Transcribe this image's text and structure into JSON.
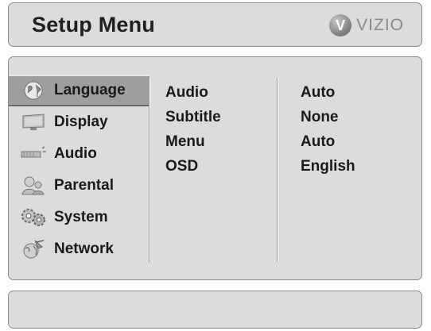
{
  "header": {
    "title": "Setup Menu",
    "logo_text": "VIZIO",
    "logo_letter": "V"
  },
  "sidebar": {
    "items": [
      {
        "label": "Language",
        "icon": "globe-icon",
        "selected": true
      },
      {
        "label": "Display",
        "icon": "monitor-icon",
        "selected": false
      },
      {
        "label": "Audio",
        "icon": "speaker-icon",
        "selected": false
      },
      {
        "label": "Parental",
        "icon": "parental-icon",
        "selected": false
      },
      {
        "label": "System",
        "icon": "gears-icon",
        "selected": false
      },
      {
        "label": "Network",
        "icon": "network-icon",
        "selected": false
      }
    ]
  },
  "settings": {
    "names": [
      "Audio",
      "Subtitle",
      "Menu",
      "OSD"
    ],
    "values": [
      "Auto",
      "None",
      "Auto",
      "English"
    ]
  },
  "colors": {
    "panel_bg": "#dcdcdc",
    "selected_bg": "#9e9e9e",
    "text": "#1a1a1a"
  }
}
